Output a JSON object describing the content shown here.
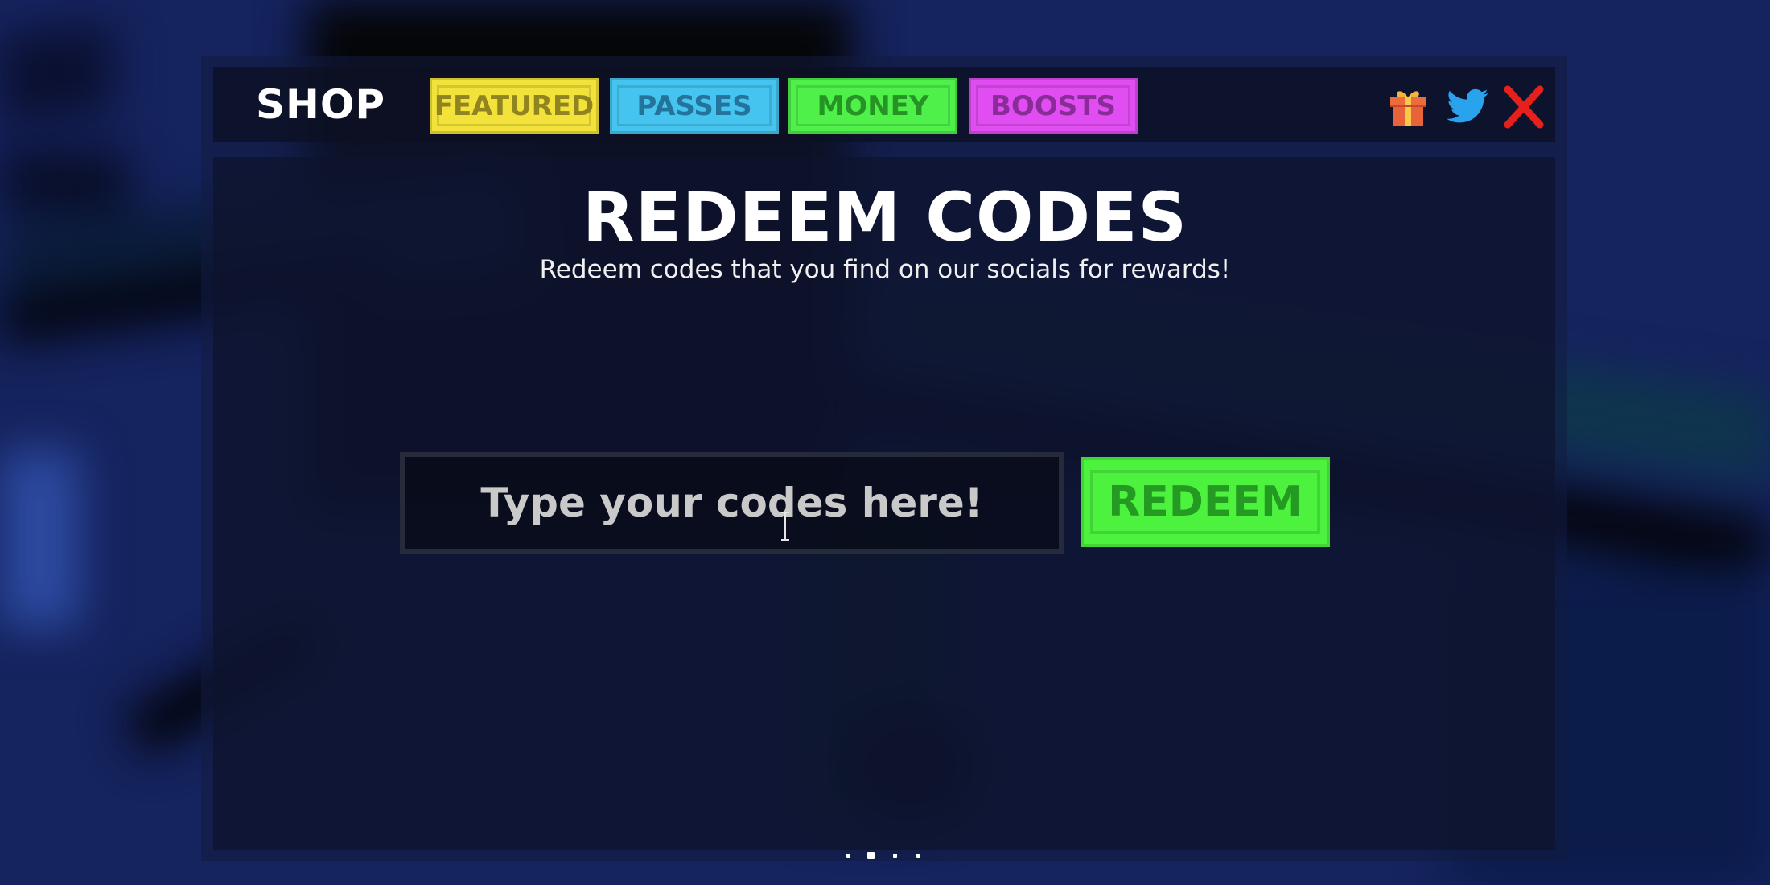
{
  "header": {
    "title": "SHOP",
    "tabs": [
      {
        "id": "featured",
        "label": "FEATURED",
        "color": "#f2e23a",
        "text_color": "#8f8420"
      },
      {
        "id": "passes",
        "label": "PASSES",
        "color": "#45c4f0",
        "text_color": "#23739a"
      },
      {
        "id": "money",
        "label": "MONEY",
        "color": "#4ff04a",
        "text_color": "#259424"
      },
      {
        "id": "boosts",
        "label": "BOOSTS",
        "color": "#e04df0",
        "text_color": "#8a2c98"
      }
    ],
    "icons": [
      {
        "name": "gift-icon",
        "label": "Gifts"
      },
      {
        "name": "twitter-icon",
        "label": "Twitter codes"
      },
      {
        "name": "close-icon",
        "label": "Close"
      }
    ]
  },
  "main": {
    "title": "REDEEM CODES",
    "subtitle": "Redeem codes that you find on our socials for rewards!",
    "code_input": {
      "value": "",
      "placeholder": "Type your codes here!"
    },
    "redeem_button": {
      "label": "REDEEM",
      "color": "#4cf23e",
      "text_color": "#249a22"
    }
  },
  "pagination": {
    "count": 4,
    "active_index": 1
  },
  "colors": {
    "background": "#15235e",
    "close_red": "#e8201c",
    "twitter_blue": "#2aa3ef"
  }
}
